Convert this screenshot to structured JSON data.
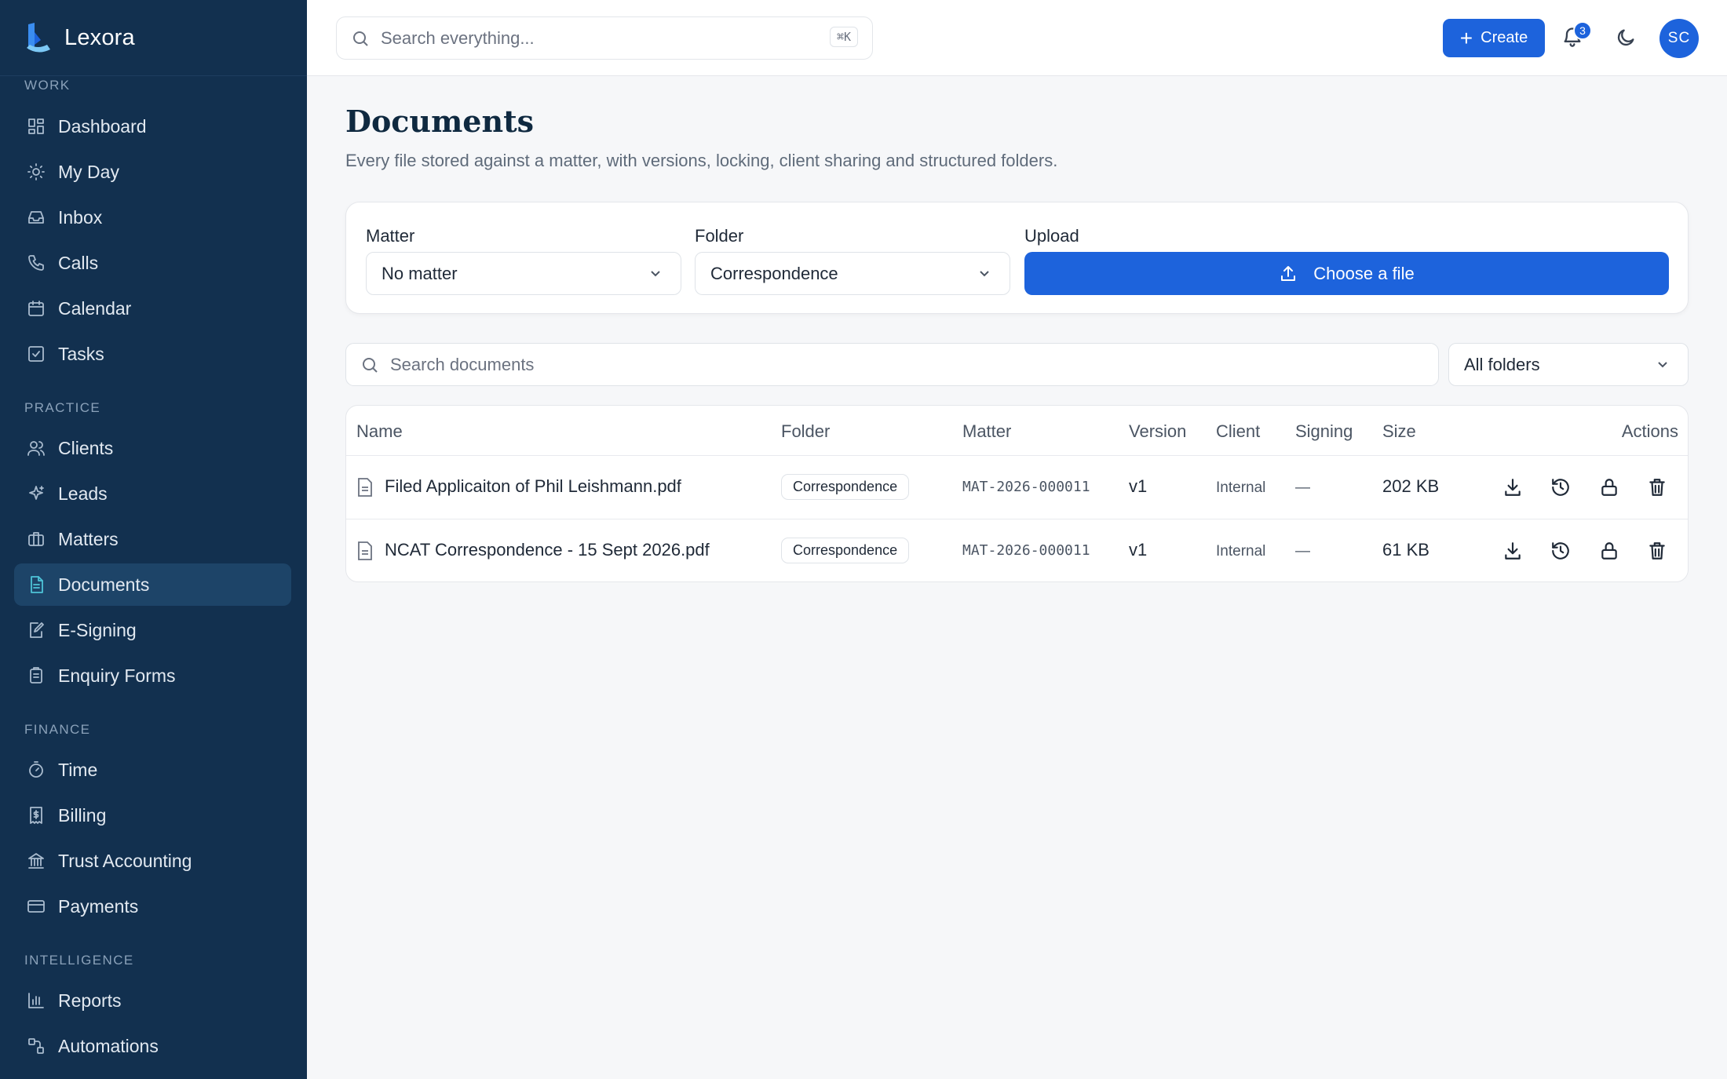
{
  "app": {
    "name": "Lexora"
  },
  "sidebar": {
    "sections": [
      {
        "label": "WORK",
        "items": [
          {
            "label": "Dashboard",
            "icon": "dashboard-icon"
          },
          {
            "label": "My Day",
            "icon": "sun-icon"
          },
          {
            "label": "Inbox",
            "icon": "inbox-icon"
          },
          {
            "label": "Calls",
            "icon": "phone-icon"
          },
          {
            "label": "Calendar",
            "icon": "calendar-icon"
          },
          {
            "label": "Tasks",
            "icon": "checkbox-icon"
          }
        ]
      },
      {
        "label": "PRACTICE",
        "items": [
          {
            "label": "Clients",
            "icon": "users-icon"
          },
          {
            "label": "Leads",
            "icon": "sparkle-icon"
          },
          {
            "label": "Matters",
            "icon": "briefcase-icon"
          },
          {
            "label": "Documents",
            "icon": "document-icon",
            "active": true
          },
          {
            "label": "E-Signing",
            "icon": "pen-icon"
          },
          {
            "label": "Enquiry Forms",
            "icon": "clipboard-icon"
          }
        ]
      },
      {
        "label": "FINANCE",
        "items": [
          {
            "label": "Time",
            "icon": "timer-icon"
          },
          {
            "label": "Billing",
            "icon": "receipt-icon"
          },
          {
            "label": "Trust Accounting",
            "icon": "bank-icon"
          },
          {
            "label": "Payments",
            "icon": "card-icon"
          }
        ]
      },
      {
        "label": "INTELLIGENCE",
        "items": [
          {
            "label": "Reports",
            "icon": "bar-chart-icon"
          },
          {
            "label": "Automations",
            "icon": "workflow-icon"
          }
        ]
      }
    ]
  },
  "topbar": {
    "search_placeholder": "Search everything...",
    "shortcut": "⌘K",
    "create_label": "Create",
    "notifications_count": "3",
    "avatar_initials": "SC"
  },
  "page": {
    "title": "Documents",
    "subtitle": "Every file stored against a matter, with versions, locking, client sharing and structured folders."
  },
  "upload": {
    "matter_label": "Matter",
    "matter_value": "No matter",
    "folder_label": "Folder",
    "folder_value": "Correspondence",
    "upload_label": "Upload",
    "choose_label": "Choose a file"
  },
  "filters": {
    "search_placeholder": "Search documents",
    "folder_value": "All folders"
  },
  "table": {
    "columns": {
      "name": "Name",
      "folder": "Folder",
      "matter": "Matter",
      "version": "Version",
      "client": "Client",
      "signing": "Signing",
      "size": "Size",
      "actions": "Actions"
    },
    "rows": [
      {
        "name": "Filed Applicaiton of Phil Leishmann.pdf",
        "folder": "Correspondence",
        "matter": "MAT-2026-000011",
        "version": "v1",
        "client": "Internal",
        "signing": "—",
        "size": "202 KB"
      },
      {
        "name": "NCAT Correspondence - 15 Sept 2026.pdf",
        "folder": "Correspondence",
        "matter": "MAT-2026-000011",
        "version": "v1",
        "client": "Internal",
        "signing": "—",
        "size": "61 KB"
      }
    ]
  },
  "colors": {
    "sidebar": "#12304f",
    "accent": "#1d63dc",
    "active_item": "#1d4468"
  }
}
